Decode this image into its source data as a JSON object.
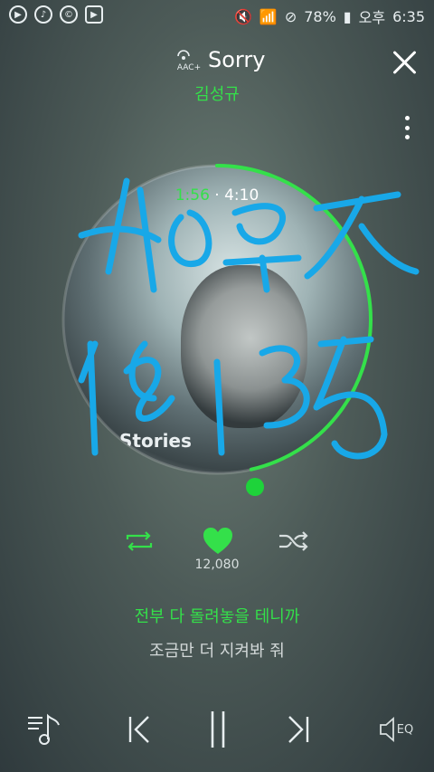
{
  "status": {
    "battery": "78%",
    "ampm": "오후",
    "time": "6:35"
  },
  "header": {
    "badge": "AAC+",
    "title": "Sorry",
    "artist": "김성규"
  },
  "player": {
    "current_time": "1:56",
    "separator": "·",
    "total_time": "4:10",
    "progress_fraction": 0.464,
    "album_text": "Stories",
    "likes": "12,080"
  },
  "lyrics": {
    "current": "전부 다 돌려놓을 테니까",
    "next": "조금만 더 지켜봐 줘"
  },
  "controls": {
    "eq_label": "EQ"
  },
  "colors": {
    "accent": "#34e04a",
    "knob": "#1ed33a",
    "annotation": "#18a8e8"
  }
}
